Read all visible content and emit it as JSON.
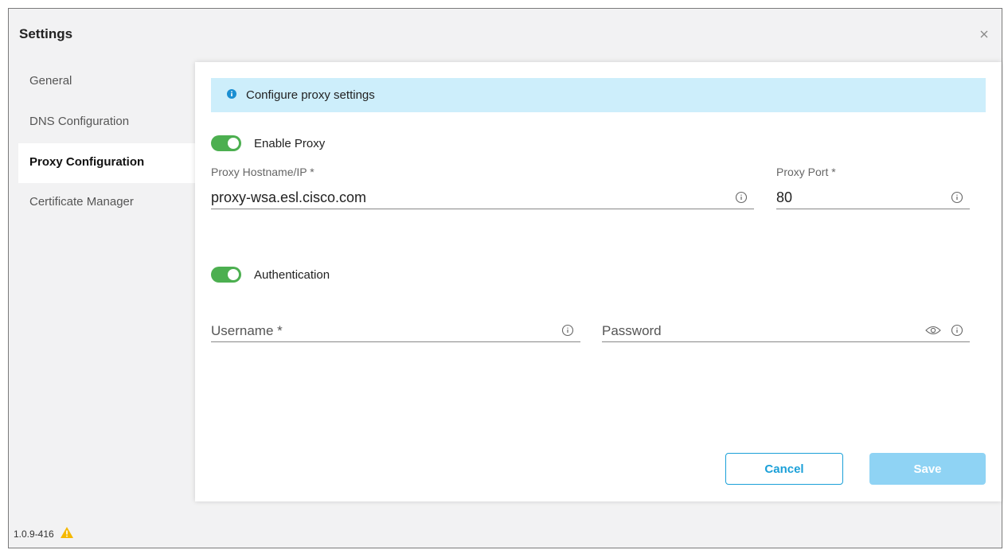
{
  "window": {
    "title": "Settings",
    "version": "1.0.9-416"
  },
  "sidebar": {
    "items": [
      {
        "label": "General",
        "active": false
      },
      {
        "label": "DNS Configuration",
        "active": false
      },
      {
        "label": "Proxy Configuration",
        "active": true
      },
      {
        "label": "Certificate Manager",
        "active": false
      }
    ]
  },
  "proxy": {
    "banner": "Configure proxy settings",
    "enable_proxy": {
      "label": "Enable Proxy",
      "on": true
    },
    "hostname": {
      "label": "Proxy Hostname/IP *",
      "value": "proxy-wsa.esl.cisco.com"
    },
    "port": {
      "label": "Proxy Port *",
      "value": "80"
    },
    "authentication": {
      "label": "Authentication",
      "on": true
    },
    "username": {
      "placeholder": "Username *",
      "value": ""
    },
    "password": {
      "placeholder": "Password",
      "value": ""
    }
  },
  "actions": {
    "cancel_label": "Cancel",
    "save_label": "Save"
  },
  "colors": {
    "accent": "#1ba0d8",
    "toggle_on": "#4caf50",
    "banner_bg": "#cdeefb",
    "warning": "#f5b800",
    "save_disabled": "#8fd3f4"
  },
  "icons": {
    "close": "close-icon",
    "info": "info-icon",
    "eye": "eye-icon",
    "warning": "warning-icon"
  }
}
